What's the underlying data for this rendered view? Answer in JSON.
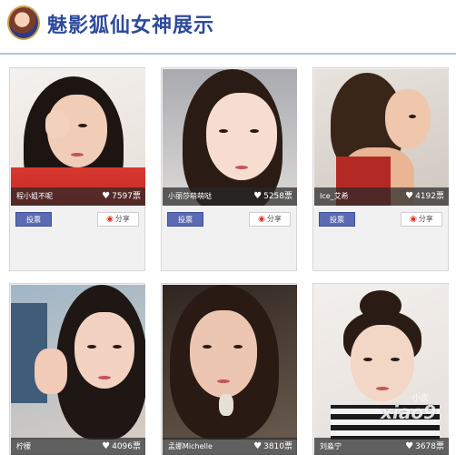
{
  "header": {
    "title": "魅影狐仙女神展示"
  },
  "cards": [
    {
      "name": "程小姐不呢",
      "votes": "7597票",
      "vote_label": "投票",
      "share_label": "分享"
    },
    {
      "name": "小丽莎萌萌哒",
      "votes": "5258票",
      "vote_label": "投票",
      "share_label": "分享"
    },
    {
      "name": "Ice_艾希",
      "votes": "4192票",
      "vote_label": "投票",
      "share_label": "分享"
    },
    {
      "name": "柠檬",
      "votes": "4096票"
    },
    {
      "name": "孟娜Michelle",
      "votes": "3810票"
    },
    {
      "name": "刘淼宁",
      "votes": "3678票"
    }
  ],
  "watermark": {
    "site": "xiao9",
    "small": "小皮"
  },
  "colors": {
    "title": "#2e4a9b",
    "vote_button": "#5b6bb3",
    "weibo": "#d9352a"
  },
  "icons": {
    "votes": "heart-icon",
    "share": "weibo-icon"
  }
}
